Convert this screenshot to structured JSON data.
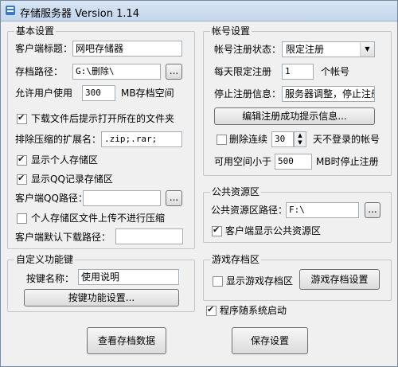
{
  "window": {
    "title": "存储服务器 Version 1.14"
  },
  "basic": {
    "legend": "基本设置",
    "client_title_label": "客户端标题：",
    "client_title_value": "网吧存储器",
    "archive_path_label": "存档路径：",
    "archive_path_value": "G:\\删除\\",
    "browse_label": "...",
    "allow_user_label": "允许用户使用",
    "allow_user_value": "300",
    "allow_user_suffix": "MB存档空间",
    "open_folder_label": "下载文件后提示打开所在的文件夹",
    "exclude_ext_label": "排除压缩的扩展名：",
    "exclude_ext_value": ".zip;.rar;",
    "show_personal_label": "显示个人存储区",
    "show_qq_label": "显示QQ记录存储区",
    "qq_path_label": "客户端QQ路径：",
    "qq_path_value": "",
    "no_compress_label": "个人存储区文件上传不进行压缩",
    "default_dl_label": "客户端默认下载路径：",
    "default_dl_value": ""
  },
  "account": {
    "legend": "帐号设置",
    "reg_status_label": "帐号注册状态：",
    "reg_status_value": "限定注册",
    "daily_limit_label": "每天限定注册",
    "daily_limit_value": "1",
    "daily_limit_suffix": "个帐号",
    "stop_info_label": "停止注册信息：",
    "stop_info_value": "服务器调整，停止注册",
    "edit_button": "编辑注册成功提示信息...",
    "delete_label": "删除连续",
    "delete_days": "30",
    "delete_suffix": "天不登录的帐号",
    "space_label": "可用空间小于",
    "space_value": "500",
    "space_suffix": "MB时停止注册"
  },
  "public": {
    "legend": "公共资源区",
    "path_label": "公共资源区路径：",
    "path_value": "F:\\",
    "browse_label": "...",
    "show_label": "客户端显示公共资源区"
  },
  "custom": {
    "legend": "自定义功能键",
    "key_name_label": "按键名称：",
    "key_name_value": "使用说明",
    "key_settings_button": "按键功能设置..."
  },
  "game": {
    "legend": "游戏存档区",
    "show_label": "显示游戏存档区",
    "settings_button": "游戏存档设置"
  },
  "startup_label": "程序随系统启动",
  "view_button": "查看存档数据",
  "save_button": "保存设置"
}
